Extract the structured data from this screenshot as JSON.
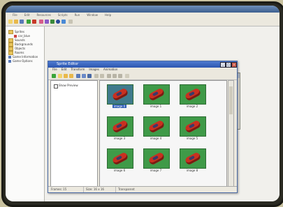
{
  "app": {
    "menu": [
      "File",
      "Edit",
      "Resources",
      "Scripts",
      "Run",
      "Window",
      "Help"
    ]
  },
  "resource_tree": {
    "items": [
      {
        "label": "Sprites",
        "kind": "folder"
      },
      {
        "label": "car_blue",
        "kind": "sprite"
      },
      {
        "label": "Sounds",
        "kind": "folder"
      },
      {
        "label": "Backgrounds",
        "kind": "folder"
      },
      {
        "label": "Objects",
        "kind": "folder"
      },
      {
        "label": "Rooms",
        "kind": "folder"
      },
      {
        "label": "Game Information",
        "kind": "info"
      },
      {
        "label": "Game Options",
        "kind": "info"
      }
    ]
  },
  "sprite_editor": {
    "title": "Sprite Editor",
    "menu": [
      "File",
      "Edit",
      "Transform",
      "Images",
      "Animation"
    ],
    "show_preview_label": "Show Preview",
    "images": [
      {
        "label": "image 0",
        "selected": true
      },
      {
        "label": "image 1",
        "selected": false
      },
      {
        "label": "image 2",
        "selected": false
      },
      {
        "label": "image 3",
        "selected": false
      },
      {
        "label": "image 4",
        "selected": false
      },
      {
        "label": "image 5",
        "selected": false
      },
      {
        "label": "image 6",
        "selected": false
      },
      {
        "label": "image 7",
        "selected": false
      },
      {
        "label": "image 8",
        "selected": false
      }
    ],
    "status": {
      "frames": "Frames: 15",
      "size": "Size: 16 x 16",
      "transparency": "Transparent"
    }
  },
  "colors": {
    "thumb_bg": "#3f9a48",
    "car": "#c93020",
    "selection": "#315fb8"
  }
}
